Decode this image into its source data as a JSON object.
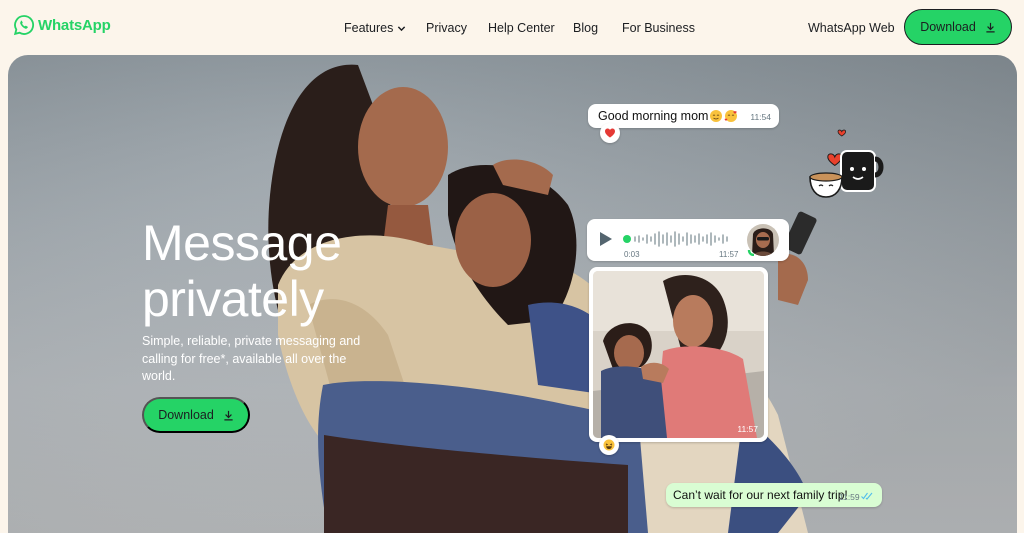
{
  "brand": {
    "name": "WhatsApp",
    "color": "#25d366",
    "icon": "whatsapp-logo-icon"
  },
  "nav": {
    "items": [
      {
        "label": "Features",
        "has_dropdown": true
      },
      {
        "label": "Privacy"
      },
      {
        "label": "Help Center"
      },
      {
        "label": "Blog"
      },
      {
        "label": "For Business"
      }
    ],
    "web_link": "WhatsApp Web",
    "download_label": "Download"
  },
  "hero": {
    "headline_line1": "Message",
    "headline_line2": "privately",
    "subtext": "Simple, reliable, private messaging and calling for free*, available all over the world.",
    "download_label": "Download"
  },
  "chat": {
    "message1": {
      "text": "Good morning mom",
      "emoji": "hugging-face, smiling-hearts",
      "time": "11:54",
      "reaction": "red-heart"
    },
    "voice_note": {
      "duration": "0:03",
      "time": "11:57"
    },
    "photo_message": {
      "time": "11:57",
      "reaction": "laughing-face"
    },
    "message2": {
      "text": "Can’t wait for our next family trip!",
      "time": "11:59",
      "status": "read"
    }
  },
  "colors": {
    "accent": "#25d366",
    "page_bg": "#fcf5eb",
    "outgoing_bubble": "#d9fdd3",
    "heart": "#e53935"
  }
}
